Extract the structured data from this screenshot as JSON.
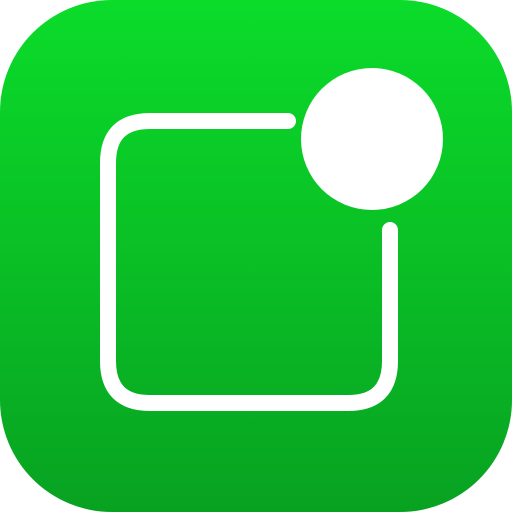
{
  "app_icon": {
    "icon": "notification-badge-icon",
    "colors": {
      "gradient_top": "#0bdc2a",
      "gradient_bottom": "#08a221",
      "glyph": "#ffffff"
    }
  }
}
